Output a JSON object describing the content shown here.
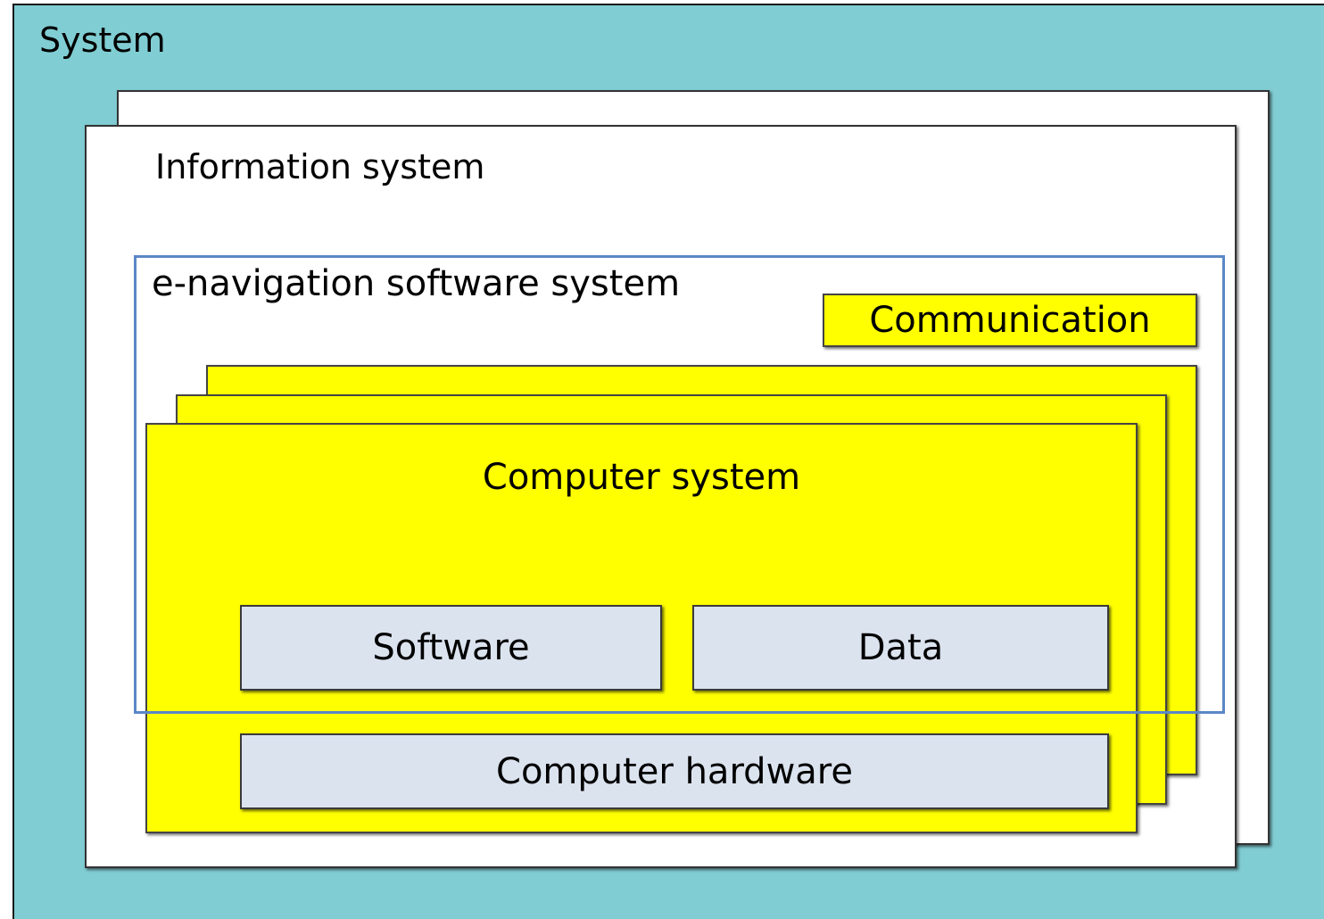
{
  "diagram": {
    "system_label": "System",
    "information_system_label": "Information system",
    "enav_label": "e-navigation software system",
    "communication_label": "Communication",
    "computer_system_label": "Computer system",
    "software_label": "Software",
    "data_label": "Data",
    "hardware_label": "Computer hardware"
  },
  "colors": {
    "system_background": "#80cdd3",
    "computer_system_fill": "#ffff00",
    "component_fill": "#dbe3ef",
    "enav_border": "#5b87c6",
    "information_system_fill": "#ffffff"
  }
}
